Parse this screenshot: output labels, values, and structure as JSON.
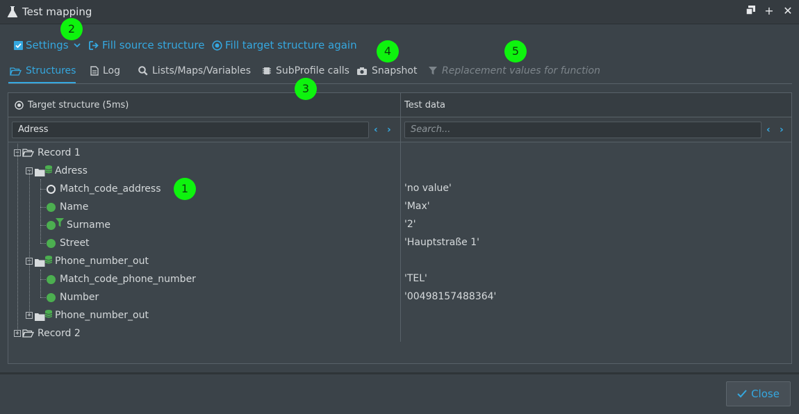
{
  "window": {
    "title": "Test mapping"
  },
  "toolbar": {
    "settings_label": "Settings",
    "fill_source_label": "Fill source structure",
    "fill_target_label": "Fill target structure again"
  },
  "tabs": [
    {
      "label": "Structures",
      "icon": "folder-open-icon",
      "active": true
    },
    {
      "label": "Log",
      "icon": "document-icon"
    },
    {
      "label": "Lists/Maps/Variables",
      "icon": "search-icon"
    },
    {
      "label": "SubProfile calls",
      "icon": "chip-icon"
    },
    {
      "label": "Snapshot",
      "icon": "camera-icon"
    },
    {
      "label": "Replacement values for function",
      "icon": "filter-icon",
      "disabled": true
    }
  ],
  "markers": [
    "1",
    "2",
    "3",
    "4",
    "5"
  ],
  "panel": {
    "left_header": "Target structure (5ms)",
    "right_header": "Test data",
    "left_filter_value": "Adress",
    "right_filter_placeholder": "Search..."
  },
  "tree": [
    {
      "label": "Record 1",
      "type": "record",
      "expander": "−"
    },
    {
      "label": "Adress",
      "type": "group",
      "expander": "−"
    },
    {
      "label": "Match_code_address",
      "type": "empty-field",
      "value": "'no value'"
    },
    {
      "label": "Name",
      "type": "field",
      "value": "'Max'"
    },
    {
      "label": "Surname",
      "type": "filtered-field",
      "value": "'2'"
    },
    {
      "label": "Street",
      "type": "field",
      "value": "'Hauptstraße 1'"
    },
    {
      "label": "Phone_number_out",
      "type": "group",
      "expander": "−"
    },
    {
      "label": "Match_code_phone_number",
      "type": "field",
      "value": "'TEL'"
    },
    {
      "label": "Number",
      "type": "field",
      "value": "'00498157488364'"
    },
    {
      "label": "Phone_number_out",
      "type": "group",
      "expander": "+"
    },
    {
      "label": "Record 2",
      "type": "record",
      "expander": "+"
    }
  ],
  "footer": {
    "close_label": "Close"
  },
  "colors": {
    "accent": "#35a8e0",
    "field_dot": "#4caf50",
    "marker": "#0ef30e"
  }
}
